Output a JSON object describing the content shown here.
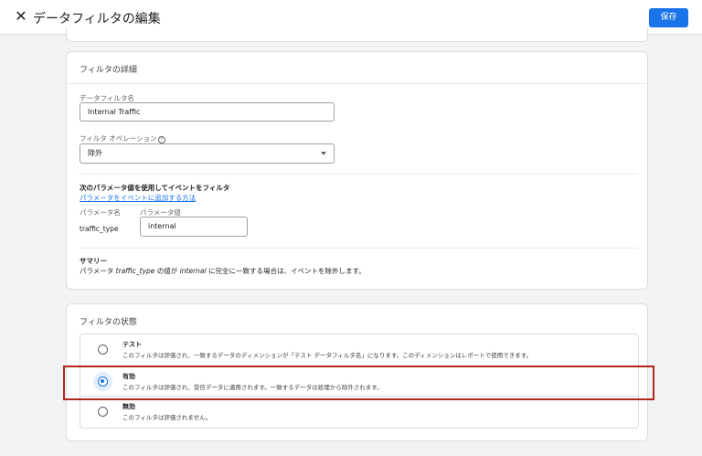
{
  "header": {
    "title": "データフィルタの編集",
    "save_label": "保存"
  },
  "details": {
    "card_title": "フィルタの詳細",
    "name_label": "データフィルタ名",
    "name_value": "Internal Traffic",
    "operation_label": "フィルタ オペレーション",
    "operation_value": "除外",
    "param_heading": "次のパラメータ値を使用してイベントをフィルタ",
    "param_link": "パラメータをイベントに追加する方法",
    "param_name_label": "パラメータ名",
    "param_value_label": "パラメータ値",
    "param_name": "traffic_type",
    "param_value": "internal",
    "summary_heading": "サマリー",
    "summary_prefix": "パラメータ ",
    "summary_param": "traffic_type",
    "summary_middle": " の値が ",
    "summary_value": "internal",
    "summary_suffix": " に完全に一致する場合は、イベントを除外します。"
  },
  "status": {
    "card_title": "フィルタの状態",
    "options": [
      {
        "title": "テスト",
        "description": "このフィルタは評価され、一致するデータのディメンションが「テスト データフィルタ名」になります。このディメンションはレポートで使用できます。",
        "selected": false
      },
      {
        "title": "有効",
        "description": "このフィルタは評価され、受信データに適用されます。一致するデータは処理から除外されます。",
        "selected": true
      },
      {
        "title": "無効",
        "description": "このフィルタは評価されません。",
        "selected": false
      }
    ]
  },
  "colors": {
    "accent": "#1a73e8",
    "highlight_border": "#b3261e",
    "background": "#f1f3f4"
  },
  "icons": {
    "close": "close-icon",
    "help": "help-icon",
    "dropdown": "chevron-down-icon"
  }
}
